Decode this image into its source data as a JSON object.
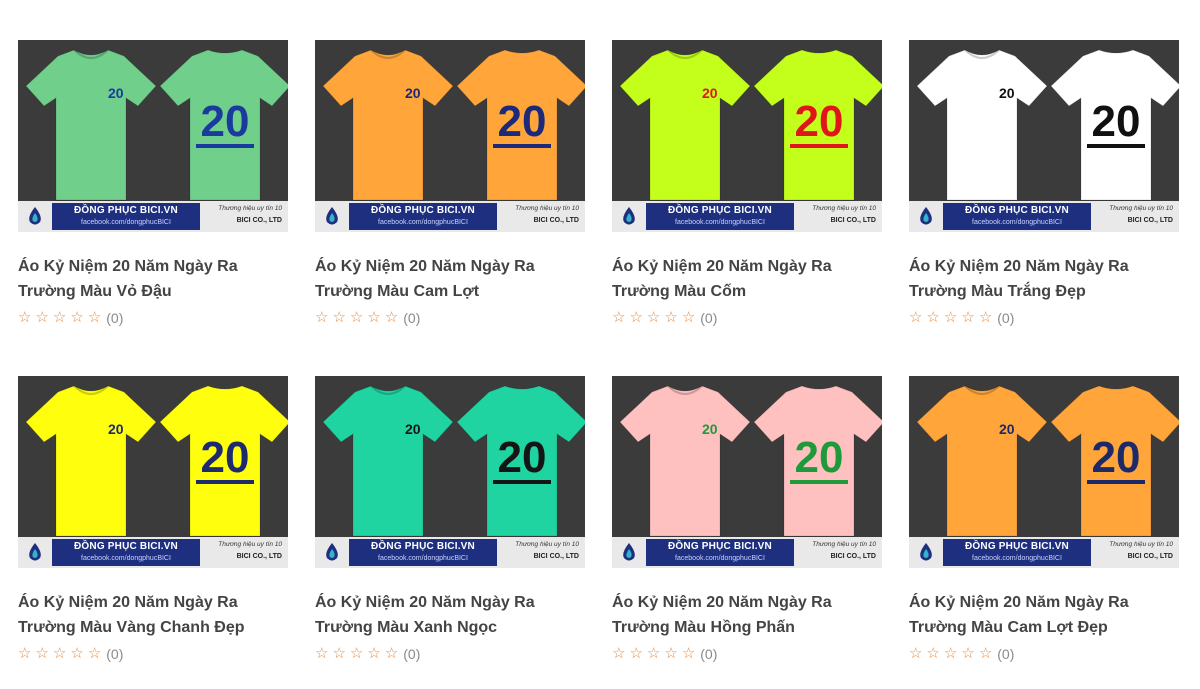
{
  "banner": {
    "brand": "ĐỒNG PHỤC BICI.VN",
    "facebook": "facebook.com/dongphucBICI",
    "slogan": "Thương hiệu uy tín 10",
    "company": "BICI CO., LTD"
  },
  "products": [
    {
      "title_line1": "Áo Kỷ Niệm 20 Năm Ngày Ra",
      "title_line2": "Trường Màu Vỏ Đậu",
      "shirt_color": "#6fcf8b",
      "print_color": "#1b3a9e",
      "print_text": "20",
      "rating": 0,
      "review_count": "(0)"
    },
    {
      "title_line1": "Áo Kỷ Niệm 20 Năm Ngày Ra",
      "title_line2": "Trường Màu Cam Lợt",
      "shirt_color": "#ffa53a",
      "print_color": "#1d2a7a",
      "print_text": "20",
      "rating": 0,
      "review_count": "(0)"
    },
    {
      "title_line1": "Áo Kỷ Niệm 20 Năm Ngày Ra",
      "title_line2": "Trường Màu Cốm",
      "shirt_color": "#c3ff1a",
      "print_color": "#e0171a",
      "print_text": "20",
      "rating": 0,
      "review_count": "(0)"
    },
    {
      "title_line1": "Áo Kỷ Niệm 20 Năm Ngày Ra",
      "title_line2": "Trường Màu Trắng Đẹp",
      "shirt_color": "#ffffff",
      "print_color": "#111111",
      "print_text": "20",
      "rating": 0,
      "review_count": "(0)"
    },
    {
      "title_line1": "Áo Kỷ Niệm 20 Năm Ngày Ra",
      "title_line2": "Trường Màu Vàng Chanh Đẹp",
      "shirt_color": "#ffff0d",
      "print_color": "#1e2a6e",
      "print_text": "20",
      "rating": 0,
      "review_count": "(0)"
    },
    {
      "title_line1": "Áo Kỷ Niệm 20 Năm Ngày Ra",
      "title_line2": "Trường Màu Xanh Ngọc",
      "shirt_color": "#1fd4a0",
      "print_color": "#151515",
      "print_text": "20",
      "rating": 0,
      "review_count": "(0)"
    },
    {
      "title_line1": "Áo Kỷ Niệm 20 Năm Ngày Ra",
      "title_line2": "Trường Màu Hồng Phấn",
      "shirt_color": "#ffc0c0",
      "print_color": "#1e9a3a",
      "print_text": "20",
      "rating": 0,
      "review_count": "(0)"
    },
    {
      "title_line1": "Áo Kỷ Niệm 20 Năm Ngày Ra",
      "title_line2": "Trường Màu Cam Lợt Đẹp",
      "shirt_color": "#ffa53a",
      "print_color": "#1d2a6a",
      "print_text": "20",
      "rating": 0,
      "review_count": "(0)"
    }
  ],
  "colors": {
    "star": "#ef8833",
    "thumb_bg": "#3b3b3b",
    "banner_blue": "#1e2f80"
  },
  "icons": {
    "star": "star-outline-icon",
    "logo": "bici-logo-icon"
  }
}
